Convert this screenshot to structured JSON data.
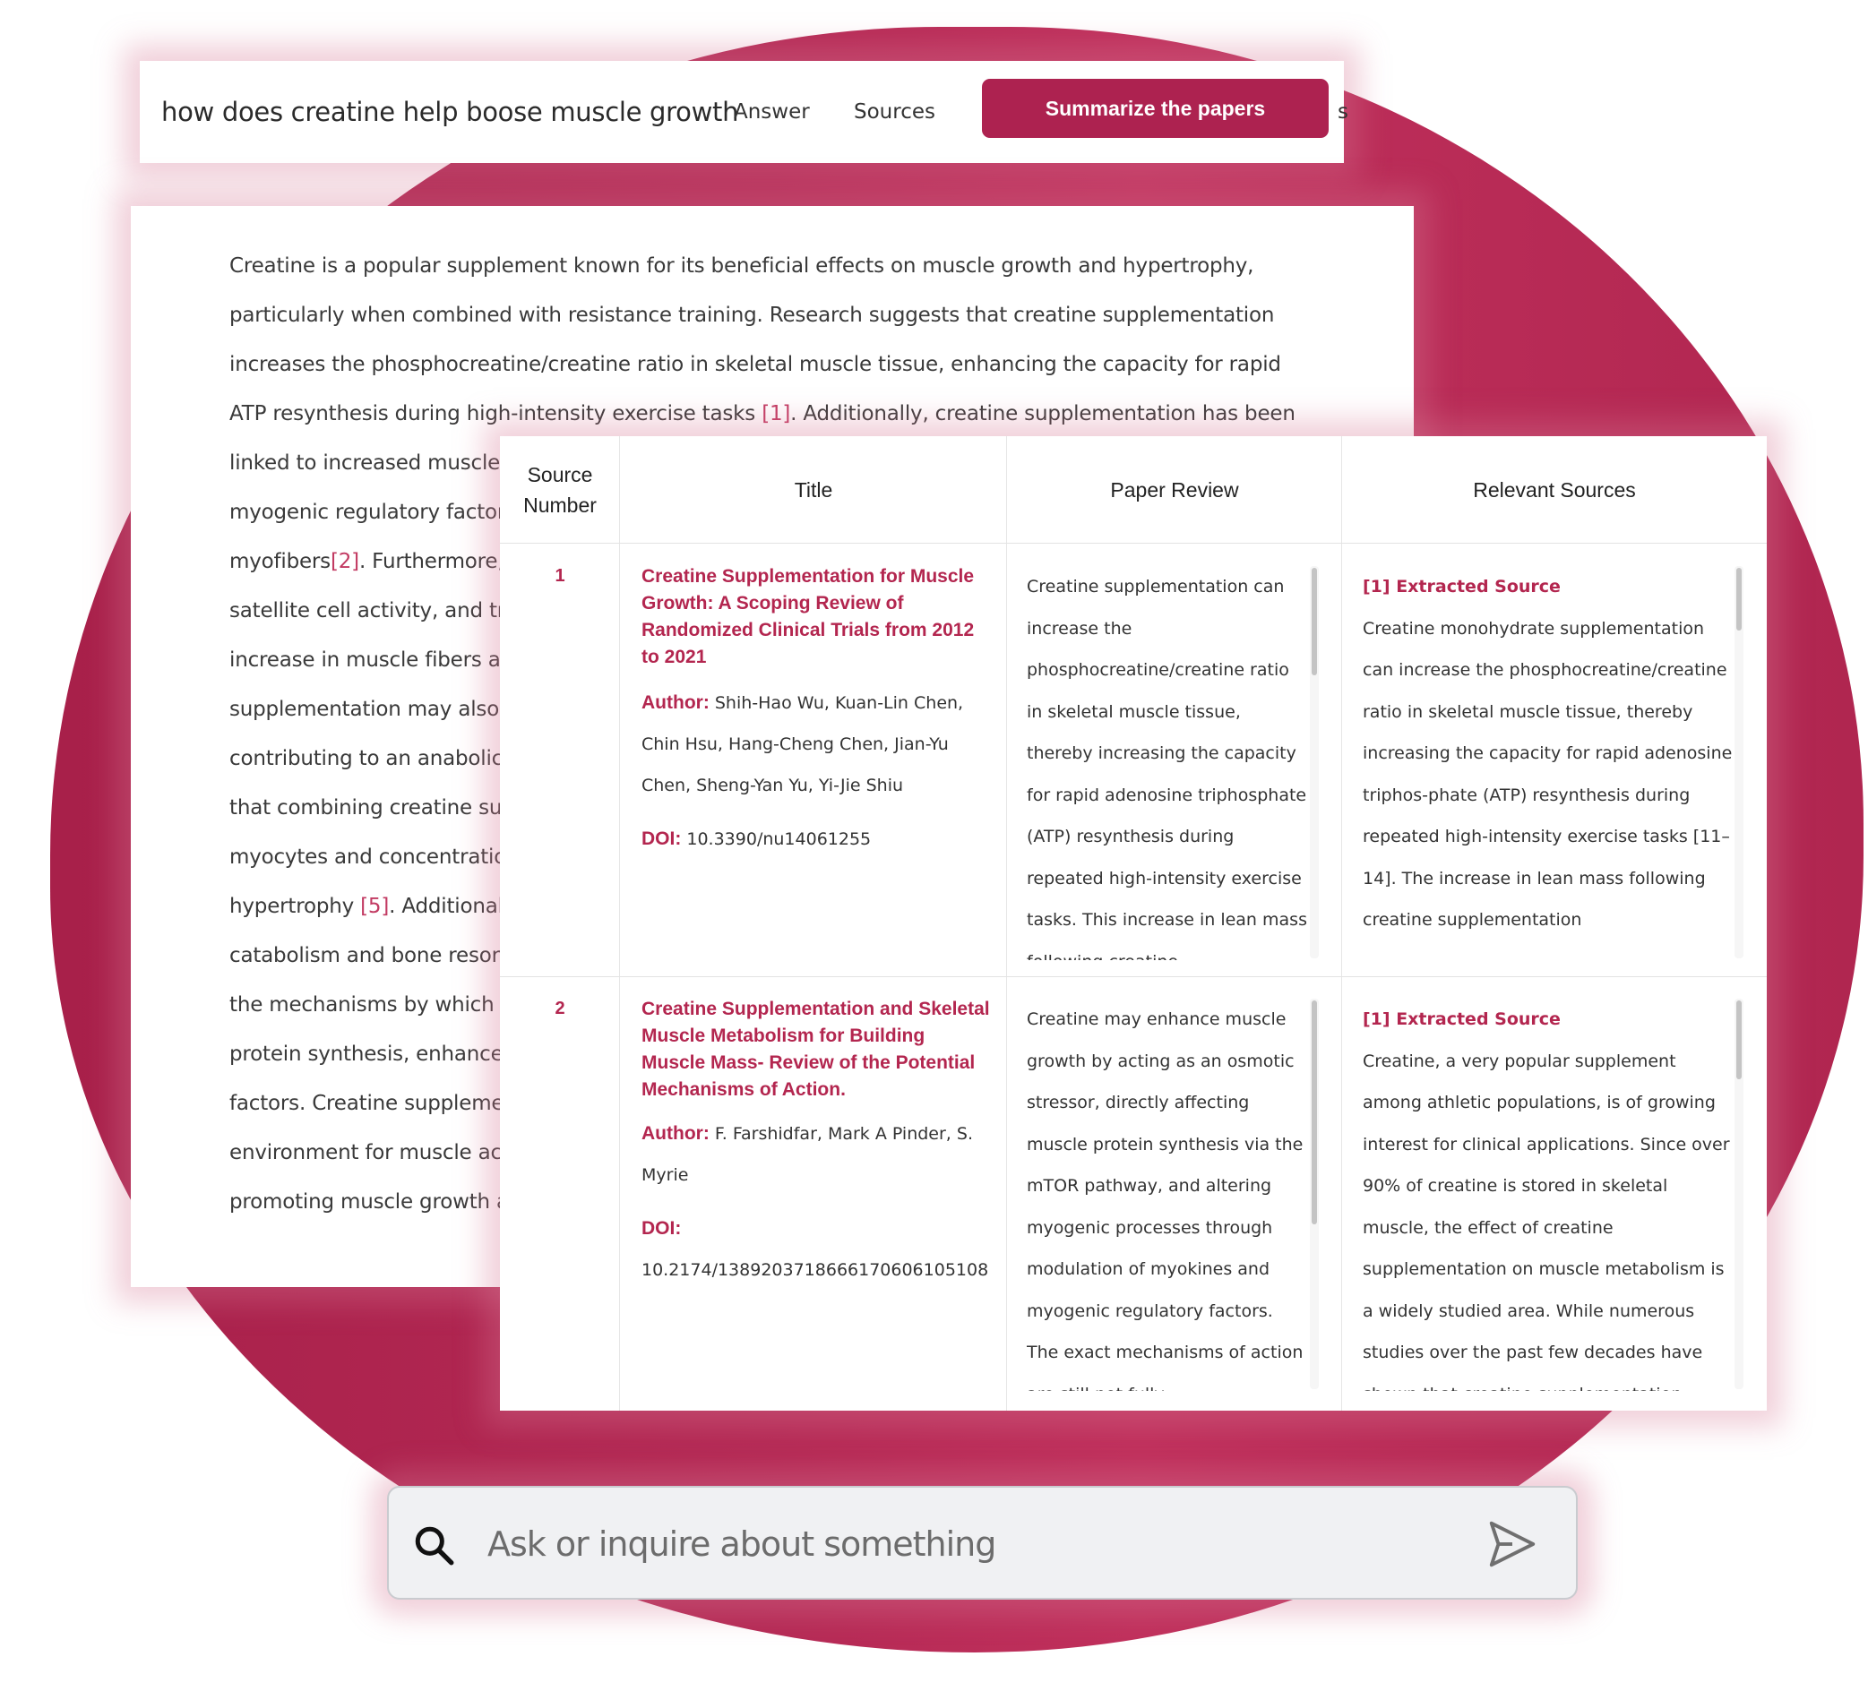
{
  "colors": {
    "accent": "#ad2250",
    "citation": "#c23a62",
    "blob": "#b52a55"
  },
  "topbar": {
    "query": "how does creatine help boose muscle growth",
    "nav": [
      "Answer",
      "Sources"
    ],
    "summarize_label": "Summarize the papers",
    "truncated_item": "s"
  },
  "answer": {
    "lines": [
      {
        "text": "Creatine is a popular supplement known for its beneficial effects on muscle growth and hypertrophy,"
      },
      {
        "text": "particularly when combined with resistance training. Research suggests that creatine supplementation"
      },
      {
        "text": "increases the phosphocreatine/creatine ratio in skeletal muscle tissue, enhancing the capacity for rapid"
      },
      {
        "text": "ATP resynthesis during high-intensity exercise tasks ",
        "cite": "[1]",
        "after": ". Additionally, creatine supplementation has been"
      },
      {
        "text": "linked to increased muscle"
      },
      {
        "text": "myogenic regulatory factor"
      },
      {
        "text": "myofibers",
        "cite": "[2]",
        "after": ". Furthermore,"
      },
      {
        "text": "satellite cell activity, and tra"
      },
      {
        "text": "increase in muscle fibers ar"
      },
      {
        "text": "supplementation may also i"
      },
      {
        "text": "contributing to an anabolic"
      },
      {
        "text": "that combining creatine su"
      },
      {
        "text": "myocytes and concentratio"
      },
      {
        "text": "hypertrophy ",
        "cite": "[5]",
        "after": ". Additionall"
      },
      {
        "text": "catabolism and bone resorp"
      },
      {
        "text": "the mechanisms by which c"
      },
      {
        "text": "protein synthesis, enhance"
      },
      {
        "text": "factors. Creatine suppleme"
      },
      {
        "text": "environment for muscle acc"
      },
      {
        "text": "promoting muscle growth a"
      }
    ]
  },
  "table": {
    "headers": [
      "Source\nNumber",
      "Title",
      "Paper Review",
      "Relevant Sources"
    ],
    "rows": [
      {
        "number": "1",
        "title": "Creatine Supplementation for Muscle Growth: A Scoping Review of Randomized Clinical Trials from 2012 to 2021",
        "author_label": "Author:",
        "authors": "Shih-Hao Wu, Kuan-Lin Chen, Chin Hsu, Hang-Cheng Chen, Jian-Yu Chen, Sheng-Yan Yu, Yi-Jie Shiu",
        "doi_label": "DOI:",
        "doi": "10.3390/nu14061255",
        "review": "Creatine supplementation can increase the phosphocreatine/creatine ratio in skeletal muscle tissue, thereby increasing the capacity for rapid adenosine triphosphate (ATP) resynthesis during repeated high-intensity exercise tasks. This increase in lean mass following creatine",
        "source_label": "[1] Extracted Source",
        "source_text": "Creatine monohydrate supplementation can increase the phosphocreatine/creatine ratio in skeletal muscle tissue, thereby increasing the capacity for rapid adenosine triphos-phate (ATP) resynthesis during repeated high-intensity exercise tasks [11–14]. The increase in lean mass following creatine supplementation"
      },
      {
        "number": "2",
        "title": "Creatine Supplementation and Skeletal Muscle Metabolism for Building Muscle Mass- Review of the Potential Mechanisms of Action.",
        "author_label": "Author:",
        "authors": "F. Farshidfar, Mark A Pinder, S. Myrie",
        "doi_label": "DOI:",
        "doi": "10.2174/1389203718666170606105108",
        "review": "Creatine may enhance muscle growth by acting as an osmotic stressor, directly affecting muscle protein synthesis via the mTOR pathway, and altering myogenic processes through modulation of myokines and myogenic regulatory factors. The exact mechanisms of action are still not fully",
        "source_label": "[1] Extracted Source",
        "source_text": "Creatine, a very popular supplement among athletic populations, is of growing interest for clinical applications. Since over 90% of creatine is stored in skeletal muscle, the effect of creatine supplementation on muscle metabolism is a widely studied area. While numerous studies over the past few decades have shown that creatine supplementation"
      }
    ]
  },
  "search": {
    "placeholder": "Ask or inquire about something",
    "icon": "search-icon",
    "send_icon": "send-icon"
  }
}
